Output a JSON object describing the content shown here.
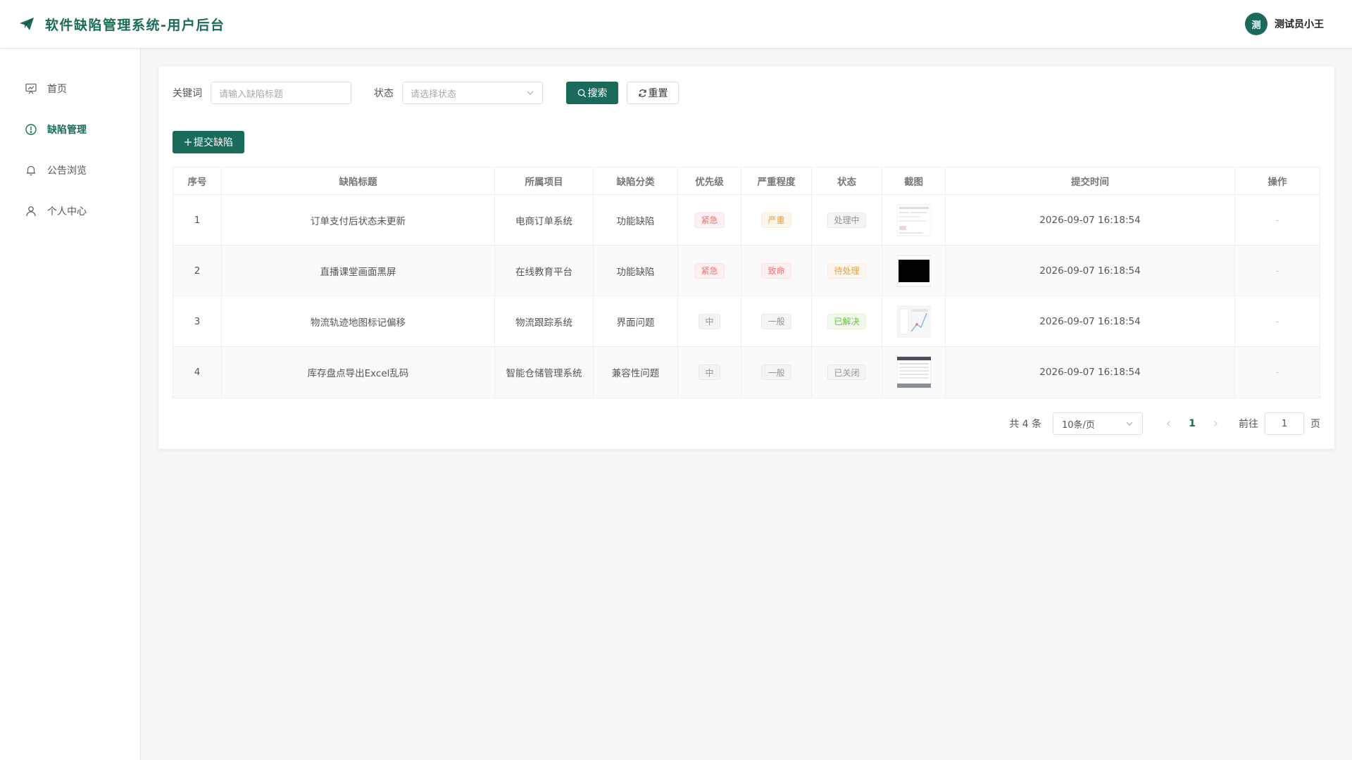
{
  "header": {
    "title": "软件缺陷管理系统-用户后台",
    "avatar_text": "测",
    "user_name": "测试员小王"
  },
  "sidebar": {
    "items": [
      {
        "label": "首页",
        "icon": "dashboard-icon",
        "active": false
      },
      {
        "label": "缺陷管理",
        "icon": "alert-circle-icon",
        "active": true
      },
      {
        "label": "公告浏览",
        "icon": "bell-icon",
        "active": false
      },
      {
        "label": "个人中心",
        "icon": "user-icon",
        "active": false
      }
    ]
  },
  "filters": {
    "keyword_label": "关键词",
    "keyword_placeholder": "请输入缺陷标题",
    "status_label": "状态",
    "status_placeholder": "请选择状态",
    "search_label": "搜索",
    "reset_label": "重置"
  },
  "toolbar": {
    "add_label": "提交缺陷"
  },
  "table": {
    "columns": [
      "序号",
      "缺陷标题",
      "所属项目",
      "缺陷分类",
      "优先级",
      "严重程度",
      "状态",
      "截图",
      "提交时间",
      "操作"
    ],
    "rows": [
      {
        "index": "1",
        "title": "订单支付后状态未更新",
        "project": "电商订单系统",
        "category": "功能缺陷",
        "priority": "紧急",
        "severity": "严重",
        "status": "处理中",
        "time": "2026-09-07 16:18:54",
        "op": "-"
      },
      {
        "index": "2",
        "title": "直播课堂画面黑屏",
        "project": "在线教育平台",
        "category": "功能缺陷",
        "priority": "紧急",
        "severity": "致命",
        "status": "待处理",
        "time": "2026-09-07 16:18:54",
        "op": "-"
      },
      {
        "index": "3",
        "title": "物流轨迹地图标记偏移",
        "project": "物流跟踪系统",
        "category": "界面问题",
        "priority": "中",
        "severity": "一般",
        "status": "已解决",
        "time": "2026-09-07 16:18:54",
        "op": "-"
      },
      {
        "index": "4",
        "title": "库存盘点导出Excel乱码",
        "project": "智能仓储管理系统",
        "category": "兼容性问题",
        "priority": "中",
        "severity": "一般",
        "status": "已关闭",
        "time": "2026-09-07 16:18:54",
        "op": "-"
      }
    ]
  },
  "pagination": {
    "total_text": "共 4 条",
    "page_size": "10条/页",
    "current_page": "1",
    "goto_label": "前往",
    "goto_value": "1",
    "page_suffix": "页"
  },
  "colors": {
    "primary": "#1b6b5a",
    "danger": "#f56c6c",
    "warning": "#e6a23c",
    "success": "#67c23a",
    "info": "#909399"
  }
}
